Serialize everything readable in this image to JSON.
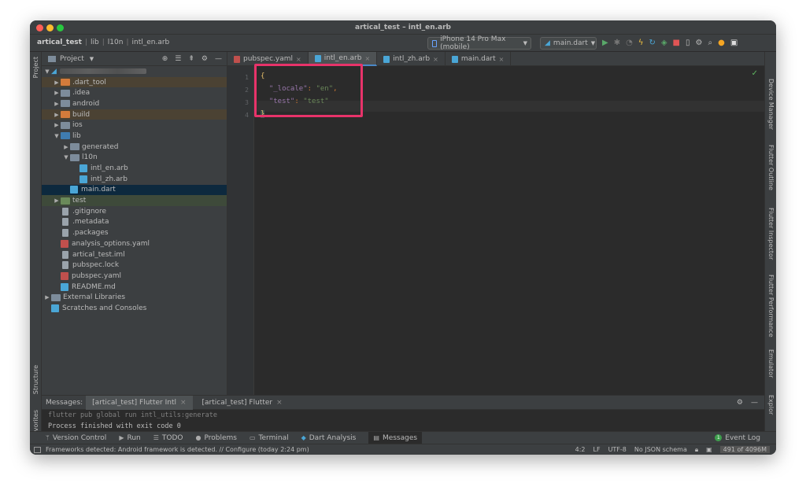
{
  "window": {
    "title": "artical_test – intl_en.arb"
  },
  "breadcrumbs": [
    "artical_test",
    "lib",
    "l10n",
    "intl_en.arb"
  ],
  "toolbar": {
    "device": "iPhone 14 Pro Max (mobile)",
    "run_config": "main.dart",
    "icons": [
      "run-icon",
      "debug-icon",
      "profile-icon",
      "hot-reload-icon",
      "hot-restart-icon",
      "coverage-icon",
      "stop-icon",
      "device-manager-icon",
      "sdk-manager-icon",
      "search-icon",
      "update-icon",
      "avatar"
    ]
  },
  "project": {
    "title": "Project",
    "root_name": "",
    "items": [
      {
        "label": ".dart_tool",
        "depth": 1,
        "kind": "folder-orange",
        "arrow": "▶",
        "hl": "brown"
      },
      {
        "label": ".idea",
        "depth": 1,
        "kind": "folder",
        "arrow": "▶"
      },
      {
        "label": "android",
        "depth": 1,
        "kind": "folder",
        "arrow": "▶"
      },
      {
        "label": "build",
        "depth": 1,
        "kind": "folder-orange",
        "arrow": "▶",
        "hl": "brown"
      },
      {
        "label": "ios",
        "depth": 1,
        "kind": "folder",
        "arrow": "▶"
      },
      {
        "label": "lib",
        "depth": 1,
        "kind": "folder-blue",
        "arrow": "▼"
      },
      {
        "label": "generated",
        "depth": 2,
        "kind": "folder",
        "arrow": "▶"
      },
      {
        "label": "l10n",
        "depth": 2,
        "kind": "folder",
        "arrow": "▼"
      },
      {
        "label": "intl_en.arb",
        "depth": 3,
        "kind": "file-dart",
        "arrow": ""
      },
      {
        "label": "intl_zh.arb",
        "depth": 3,
        "kind": "file-dart",
        "arrow": ""
      },
      {
        "label": "main.dart",
        "depth": 2,
        "kind": "file-dart",
        "arrow": "",
        "hl": "selected"
      },
      {
        "label": "test",
        "depth": 1,
        "kind": "folder-green",
        "arrow": "▶",
        "hl": "green"
      },
      {
        "label": ".gitignore",
        "depth": 1,
        "kind": "file",
        "arrow": ""
      },
      {
        "label": ".metadata",
        "depth": 1,
        "kind": "file",
        "arrow": ""
      },
      {
        "label": ".packages",
        "depth": 1,
        "kind": "file",
        "arrow": ""
      },
      {
        "label": "analysis_options.yaml",
        "depth": 1,
        "kind": "file-yaml",
        "arrow": ""
      },
      {
        "label": "artical_test.iml",
        "depth": 1,
        "kind": "file",
        "arrow": ""
      },
      {
        "label": "pubspec.lock",
        "depth": 1,
        "kind": "file",
        "arrow": ""
      },
      {
        "label": "pubspec.yaml",
        "depth": 1,
        "kind": "file-yaml",
        "arrow": ""
      },
      {
        "label": "README.md",
        "depth": 1,
        "kind": "file-dart",
        "arrow": ""
      },
      {
        "label": "External Libraries",
        "depth": 0,
        "kind": "folder",
        "arrow": "▶"
      },
      {
        "label": "Scratches and Consoles",
        "depth": 0,
        "kind": "file-dart",
        "arrow": ""
      }
    ]
  },
  "left_tool_windows": {
    "project": "Project",
    "structure": "Structure",
    "favorites": "Favorites"
  },
  "right_tool_windows": [
    "Device Manager",
    "Flutter Outline",
    "Flutter Inspector",
    "Flutter Performance",
    "Emulator",
    "Device File Explor"
  ],
  "editor": {
    "tabs": [
      {
        "label": "pubspec.yaml",
        "active": false
      },
      {
        "label": "intl_en.arb",
        "active": true
      },
      {
        "label": "intl_zh.arb",
        "active": false
      },
      {
        "label": "main.dart",
        "active": false
      }
    ],
    "line_numbers": [
      "1",
      "2",
      "3",
      "4"
    ],
    "code": {
      "open": "{",
      "k1": "\"_locale\"",
      "v1": "\"en\"",
      "k2": "\"test\"",
      "v2": "\"test\"",
      "close": "}",
      "colon": ": ",
      "comma": ","
    }
  },
  "messages": {
    "label": "Messages:",
    "tabs": [
      "[artical_test] Flutter Intl",
      "[artical_test] Flutter"
    ],
    "command": "flutter pub global run intl_utils:generate",
    "output": "Process finished with exit code 0"
  },
  "tool_windows": [
    "Version Control",
    "Run",
    "TODO",
    "Problems",
    "Terminal",
    "Dart Analysis",
    "Messages"
  ],
  "event_log": {
    "label": "Event Log",
    "count": "1"
  },
  "status": {
    "message": "Frameworks detected: Android framework is detected. // Configure (today 2:24 pm)",
    "position": "4:2",
    "line_sep": "LF",
    "encoding": "UTF-8",
    "schema": "No JSON schema",
    "memory": "491 of 4096M"
  }
}
